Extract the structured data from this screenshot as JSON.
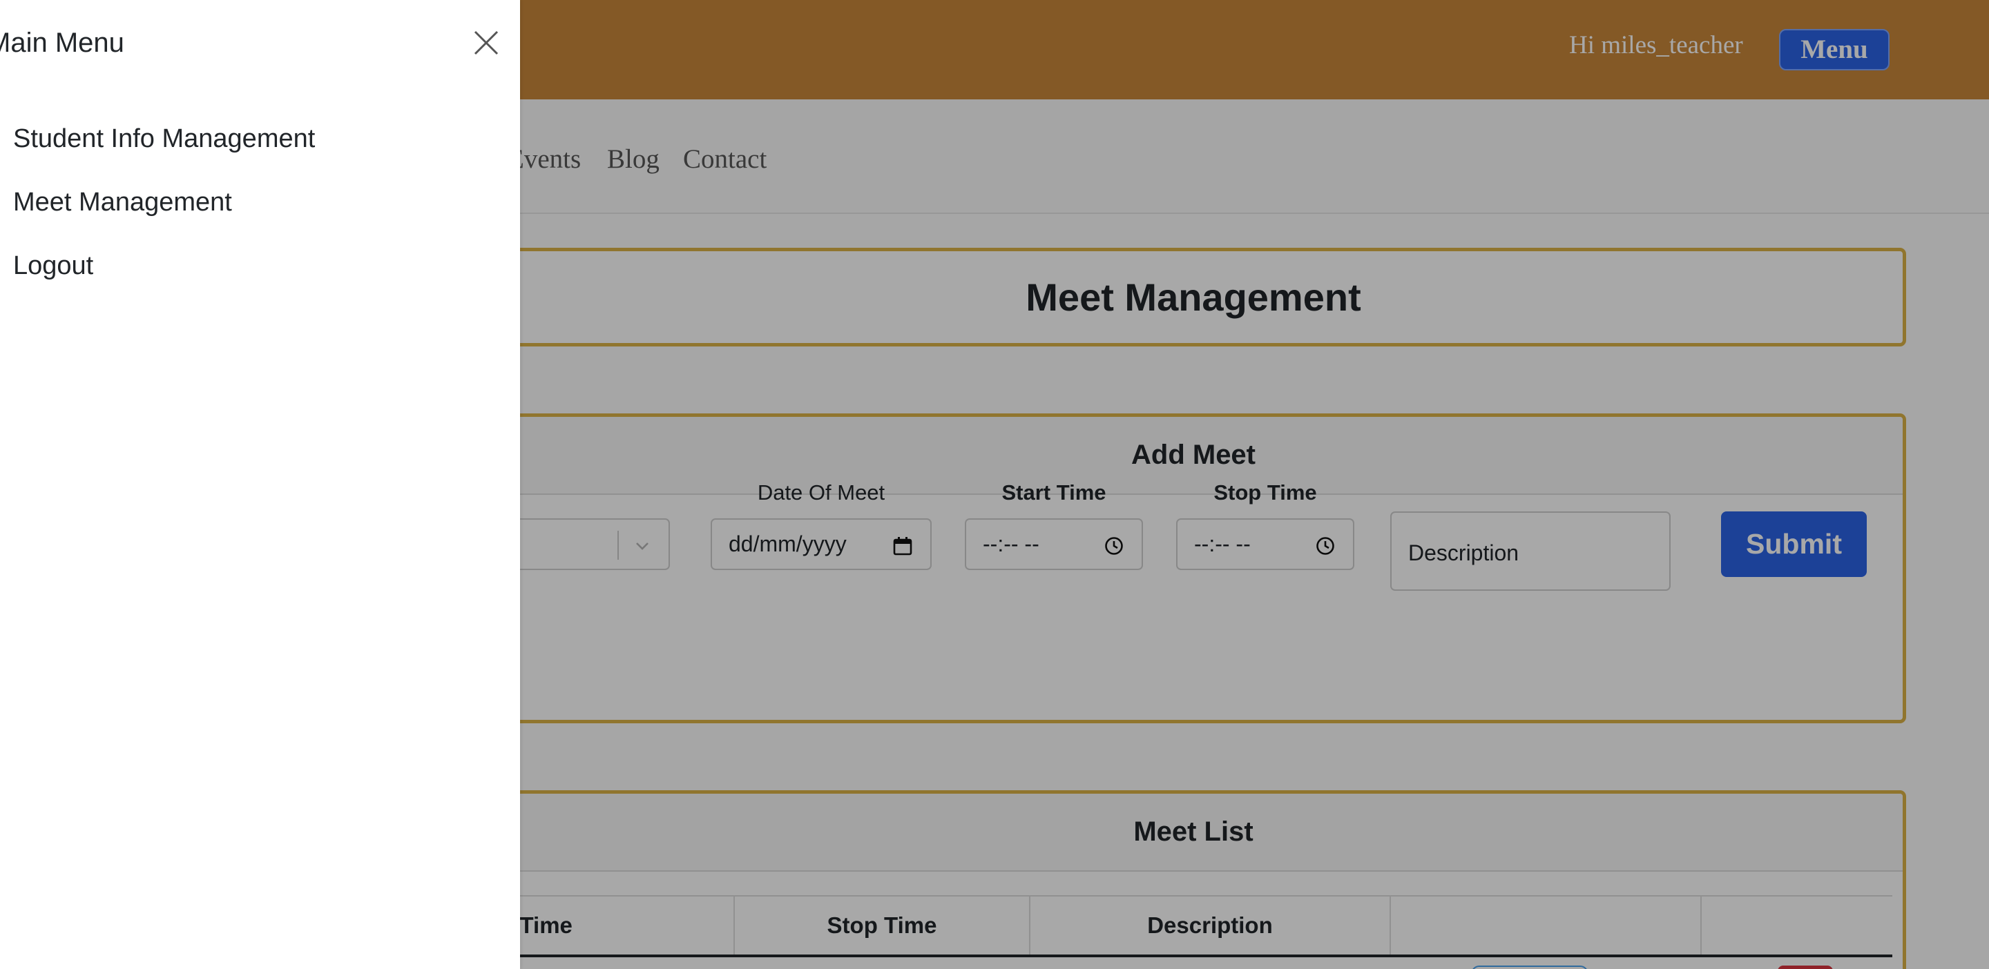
{
  "header": {
    "greeting": "Hi miles_teacher",
    "menu_label": "Menu"
  },
  "nav": {
    "links": [
      "Events",
      "Blog",
      "Contact"
    ]
  },
  "page": {
    "title": "Meet Management"
  },
  "add_meet": {
    "header": "Add Meet",
    "date_label": "Date Of Meet",
    "date_value": "dd/mm/yyyy",
    "start_label": "Start Time",
    "start_value": "--:-- --",
    "stop_label": "Stop Time",
    "stop_value": "--:-- --",
    "description_placeholder": "Description",
    "submit_label": "Submit"
  },
  "meet_list": {
    "header": "Meet List",
    "columns": [
      "Start Time",
      "Stop Time",
      "Description"
    ]
  },
  "offcanvas": {
    "title": "Main Menu",
    "items": [
      "Student Info Management",
      "Meet Management",
      "Logout"
    ]
  },
  "colors": {
    "header_bg": "#c8873a",
    "primary": "#2b63e6",
    "card_border": "#dbb246",
    "danger": "#d9343f",
    "backdrop": "rgba(0,0,0,0.34)"
  }
}
